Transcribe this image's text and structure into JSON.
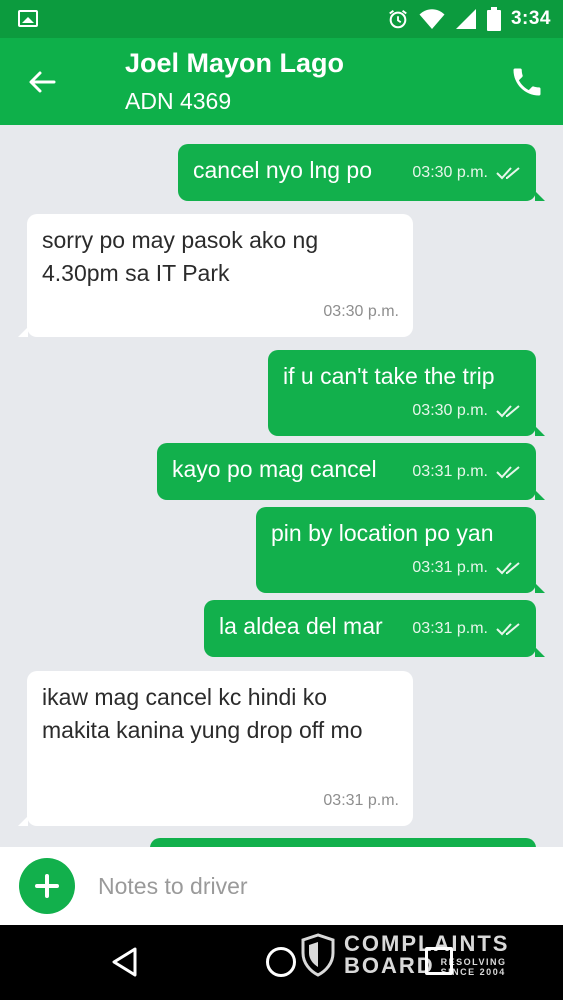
{
  "status_bar": {
    "time": "3:34"
  },
  "header": {
    "name": "Joel Mayon Lago",
    "plate": "ADN 4369"
  },
  "messages": [
    {
      "text": "cancel nyo lng po",
      "time": "03:30 p.m.",
      "dir": "out"
    },
    {
      "text": "sorry po may pasok ako ng 4.30pm sa IT Park",
      "time": "03:30 p.m.",
      "dir": "in"
    },
    {
      "text": "if u can't take the trip",
      "time": "03:30 p.m.",
      "dir": "out"
    },
    {
      "text": "kayo po mag cancel",
      "time": "03:31 p.m.",
      "dir": "out"
    },
    {
      "text": "pin by location po yan",
      "time": "03:31 p.m.",
      "dir": "out"
    },
    {
      "text": "la aldea del mar",
      "time": "03:31 p.m.",
      "dir": "out"
    },
    {
      "text": "ikaw mag cancel kc hindi ko makita kanina yung drop off mo",
      "time": "03:31 p.m.",
      "dir": "in"
    }
  ],
  "composer": {
    "placeholder": "Notes to driver"
  },
  "watermark": {
    "line1": "COMPLAINTS",
    "line2": "BOARD",
    "line3a": "RESOLVING",
    "line3b": "SINCE 2004"
  },
  "colors": {
    "status_bar": "#0c9b3e",
    "app_bar": "#0eb04a",
    "bubble_out": "#12b04c",
    "bubble_in": "#ffffff",
    "background": "#e7e9ed"
  },
  "icons": [
    "image-icon",
    "alarm-icon",
    "wifi-icon",
    "signal-icon",
    "battery-icon",
    "back-arrow-icon",
    "phone-icon",
    "read-ticks-icon",
    "plus-icon",
    "nav-back-icon",
    "nav-home-icon",
    "nav-recents-icon"
  ]
}
